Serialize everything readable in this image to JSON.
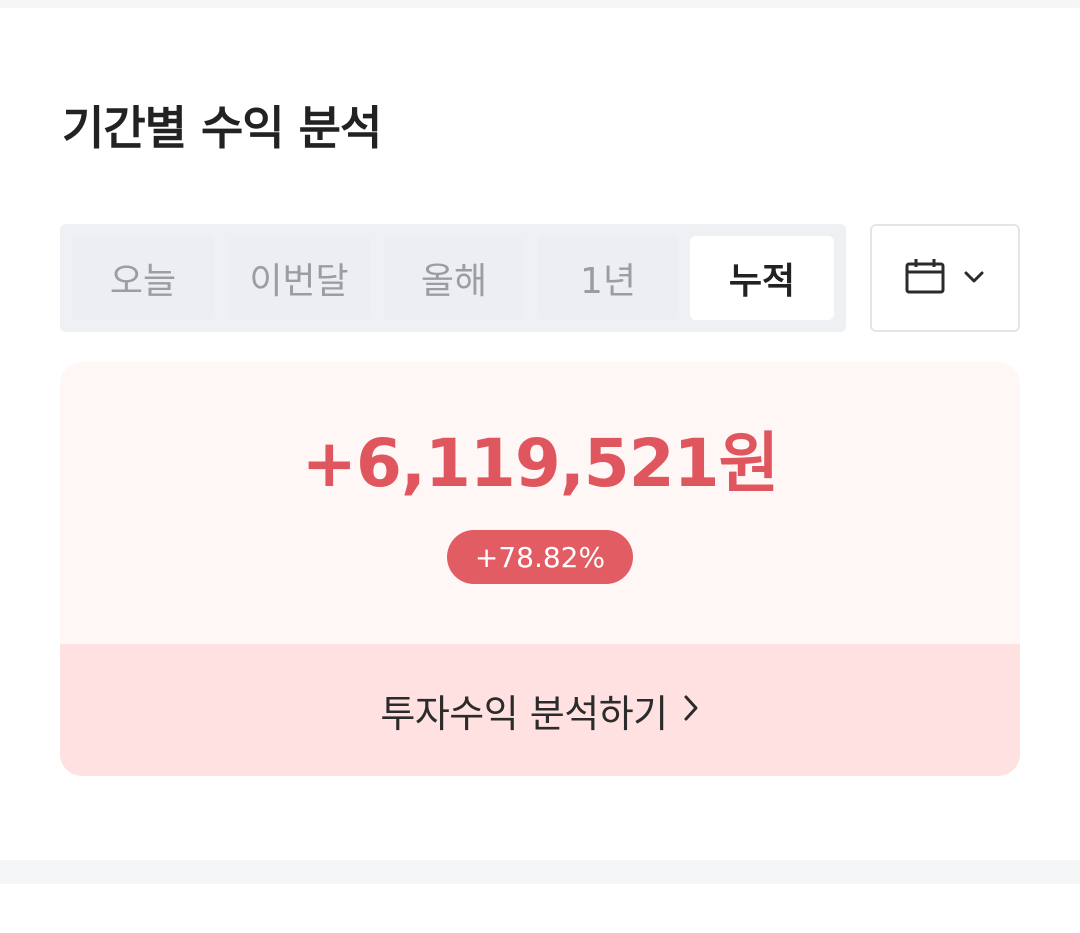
{
  "title": "기간별 수익 분석",
  "period_tabs": [
    {
      "label": "오늘",
      "active": false
    },
    {
      "label": "이번달",
      "active": false
    },
    {
      "label": "올해",
      "active": false
    },
    {
      "label": "1년",
      "active": false
    },
    {
      "label": "누적",
      "active": true
    }
  ],
  "calendar_button": {
    "icon": "calendar-icon",
    "dropdown_icon": "chevron-down-icon"
  },
  "summary": {
    "amount": "+6,119,521원",
    "rate": "+78.82%",
    "link_label": "투자수익 분석하기",
    "link_icon": "chevron-right-icon"
  },
  "colors": {
    "profit_red": "#e0565e",
    "badge_red": "#e25c63",
    "card_bg": "#fff6f6",
    "footer_bg": "#ffe1e2",
    "segment_bg": "#eef0f3"
  }
}
